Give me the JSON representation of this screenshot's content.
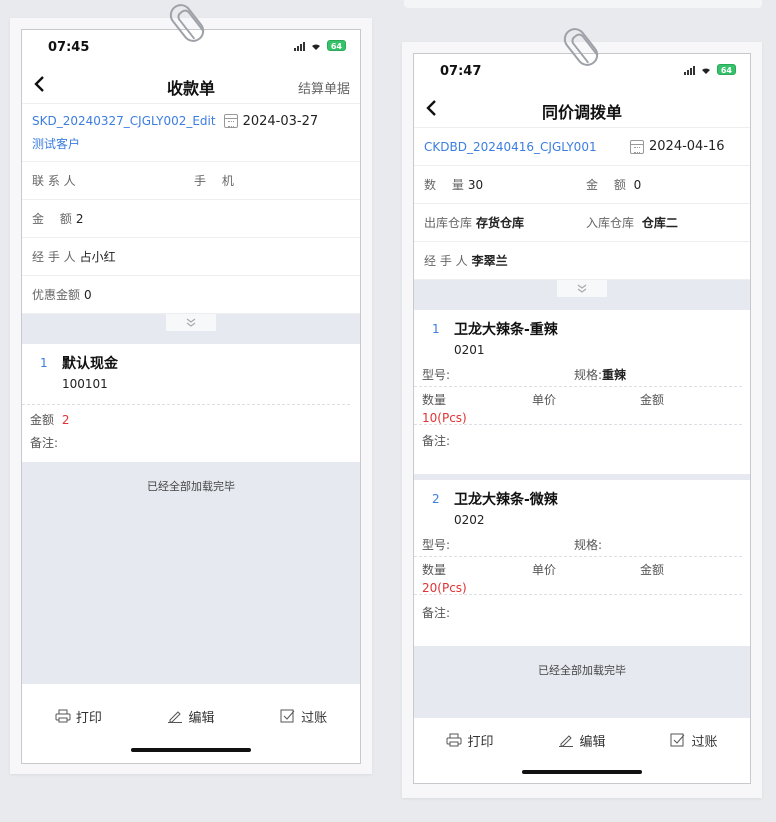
{
  "left": {
    "time": "07:45",
    "battery": "64",
    "title": "收款单",
    "nav_right": "结算单据",
    "order_no": "SKD_20240327_CJGLY002_Edit",
    "date": "2024-03-27",
    "customer": "测试客户",
    "contact_label": "联 系 人",
    "phone_label": "手　 机",
    "amount_label": "金　 额",
    "amount_value": "2",
    "handler_label": "经 手 人",
    "handler_value": "占小红",
    "discount_label": "优惠金额",
    "discount_value": "0",
    "item": {
      "num": "1",
      "name": "默认现金",
      "code": "100101",
      "amount_label": "金额",
      "amount_value": "2",
      "note_label": "备注:"
    },
    "loaded_text": "已经全部加载完毕",
    "actions": {
      "print": "打印",
      "edit": "编辑",
      "post": "过账"
    }
  },
  "right": {
    "time": "07:47",
    "battery": "64",
    "title": "同价调拨单",
    "order_no": "CKDBD_20240416_CJGLY001",
    "date": "2024-04-16",
    "qty_label": "数　 量",
    "qty_value": "30",
    "amt_label": "金　 额",
    "amt_value": "0",
    "out_wh_label": "出库仓库",
    "out_wh_value": "存货仓库",
    "in_wh_label": "入库仓库",
    "in_wh_value": "仓库二",
    "handler_label": "经 手 人",
    "handler_value": "李翠兰",
    "items": [
      {
        "num": "1",
        "name": "卫龙大辣条-重辣",
        "code": "0201",
        "model_label": "型号:",
        "spec_label": "规格:",
        "spec_value": "重辣",
        "qty_label": "数量",
        "price_label": "单价",
        "amount_label": "金额",
        "qty_value": "10(Pcs)",
        "note_label": "备注:"
      },
      {
        "num": "2",
        "name": "卫龙大辣条-微辣",
        "code": "0202",
        "model_label": "型号:",
        "spec_label": "规格:",
        "spec_value": "",
        "qty_label": "数量",
        "price_label": "单价",
        "amount_label": "金额",
        "qty_value": "20(Pcs)",
        "note_label": "备注:"
      }
    ],
    "loaded_text": "已经全部加载完毕",
    "actions": {
      "print": "打印",
      "edit": "编辑",
      "post": "过账"
    }
  }
}
